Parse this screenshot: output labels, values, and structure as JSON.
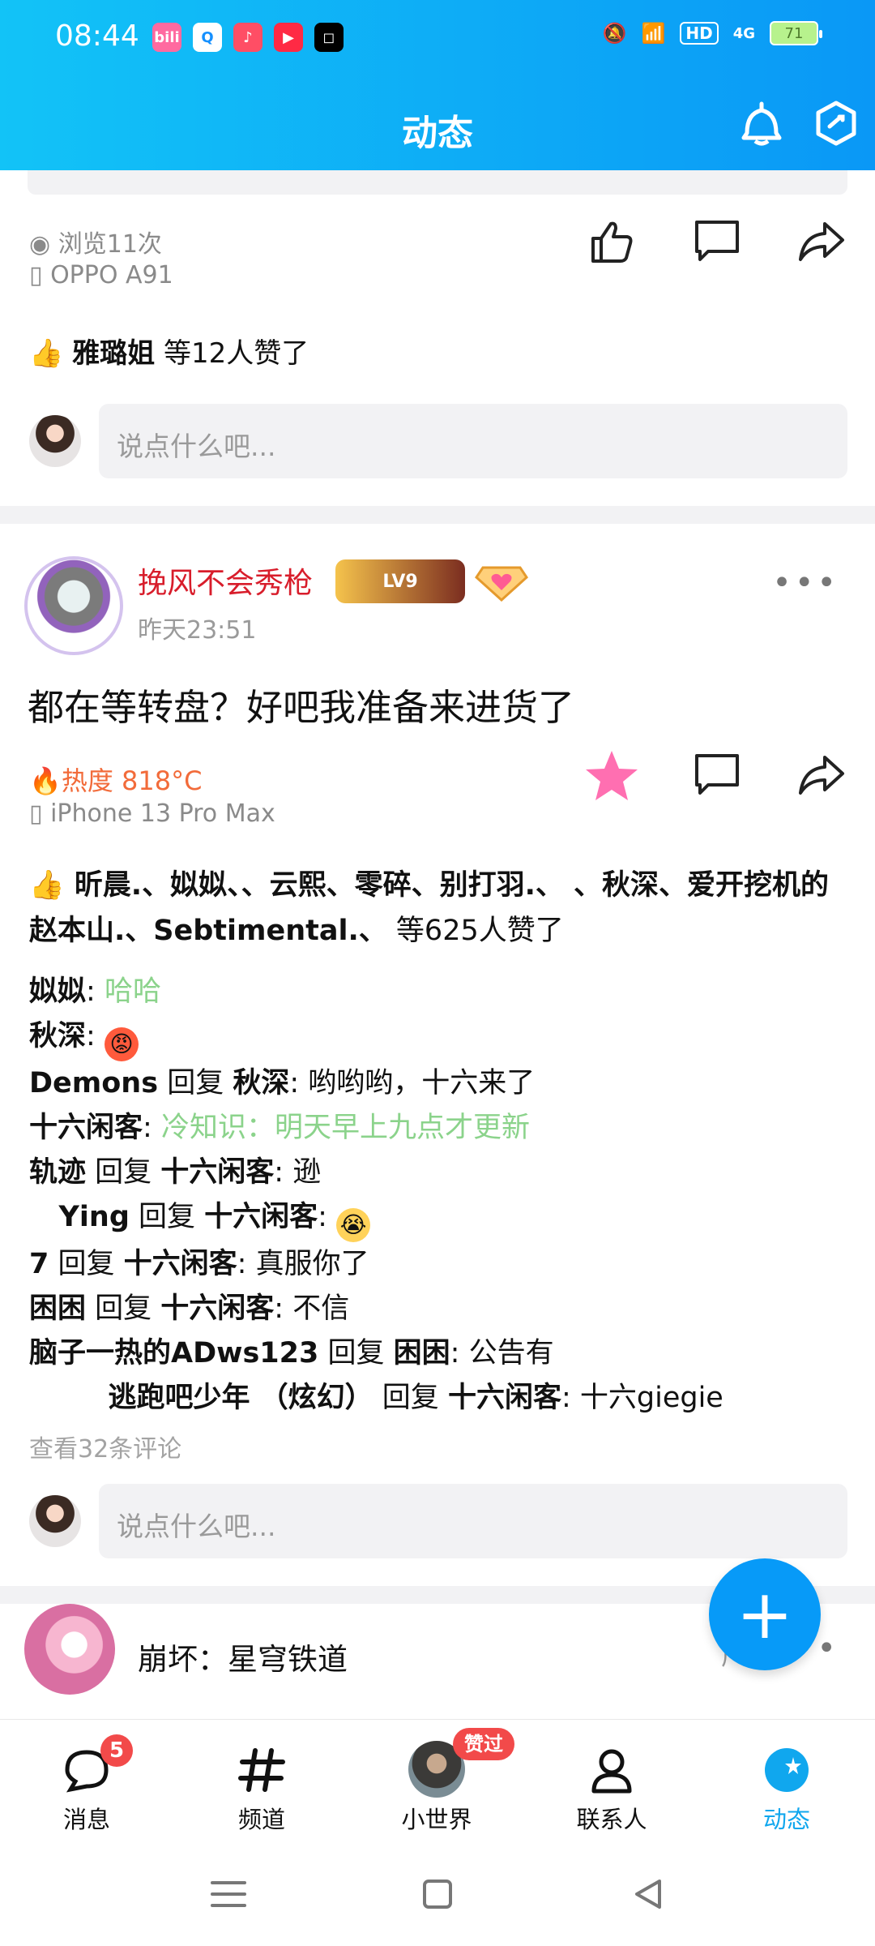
{
  "status_bar": {
    "time": "08:44",
    "apps": [
      "bili",
      "Q",
      "♪",
      "▶",
      "◻"
    ],
    "battery": "71",
    "signal": "4G"
  },
  "header": {
    "title": "动态"
  },
  "prev_post": {
    "views": "浏览11次",
    "device": "OPPO A91",
    "liked_name": "雅璐姐",
    "liked_suffix": " 等12人赞了",
    "comment_placeholder": "说点什么吧..."
  },
  "post": {
    "username": "挽风不会秀枪",
    "level": "LV9",
    "time": "昨天23:51",
    "text": "都在等转盘？好吧我准备来进货了",
    "heat": "热度 818°C",
    "device": "iPhone 13 Pro Max",
    "liked_names": "昕晨.、姒姒、、云熙、零碎、别打羽.、        、秋深、爱开挖机的赵本山.、Sebtimental.、",
    "liked_count": " 等625人赞了",
    "comments": [
      {
        "a": "姒姒",
        "sep": ": ",
        "text": "哈哈",
        "green": true
      },
      {
        "a": "秋深",
        "sep": ": ",
        "emoji": "angry"
      },
      {
        "a": "Demons",
        "reply": " 回复 ",
        "b": "秋深",
        "sep": ": ",
        "text": "哟哟哟，十六来了"
      },
      {
        "a": "十六闲客",
        "sep": ": ",
        "text": "冷知识：明天早上九点才更新",
        "green": true
      },
      {
        "a": "轨迹",
        "reply": " 回复 ",
        "b": "十六闲客",
        "sep": ": ",
        "text": "逊"
      },
      {
        "a": "   Ying",
        "reply": " 回复 ",
        "b": "十六闲客",
        "sep": ": ",
        "emoji": "cry"
      },
      {
        "a": "7",
        "reply": " 回复 ",
        "b": "十六闲客",
        "sep": ": ",
        "text": "真服你了"
      },
      {
        "a": "困困",
        "reply": " 回复 ",
        "b": "十六闲客",
        "sep": ": ",
        "text": "不信"
      },
      {
        "a": "脑子一热的ADws123",
        "reply": " 回复 ",
        "b": "困困",
        "sep": ": ",
        "text": "公告有"
      },
      {
        "a": "        逃跑吧少年 （炫幻）",
        "reply": " 回复 ",
        "b": "十六闲客",
        "sep": ": ",
        "text": "十六giegie"
      }
    ],
    "view_more": "查看32条评论",
    "comment_placeholder": "说点什么吧..."
  },
  "ad_post": {
    "name": "崩坏：星穹铁道",
    "tag": "广告"
  },
  "fab": {
    "label": "+"
  },
  "nav": {
    "items": [
      {
        "label": "消息",
        "badge": "5"
      },
      {
        "label": "频道"
      },
      {
        "label": "小世界",
        "badge": "赞过"
      },
      {
        "label": "联系人"
      },
      {
        "label": "动态"
      }
    ]
  },
  "colors": {
    "header_start": "#12c3f7",
    "header_end": "#0a98f6",
    "accent": "#10a7ee",
    "username": "#d81d2b",
    "heat": "#f26b3a",
    "green_text": "#8bd38b"
  }
}
